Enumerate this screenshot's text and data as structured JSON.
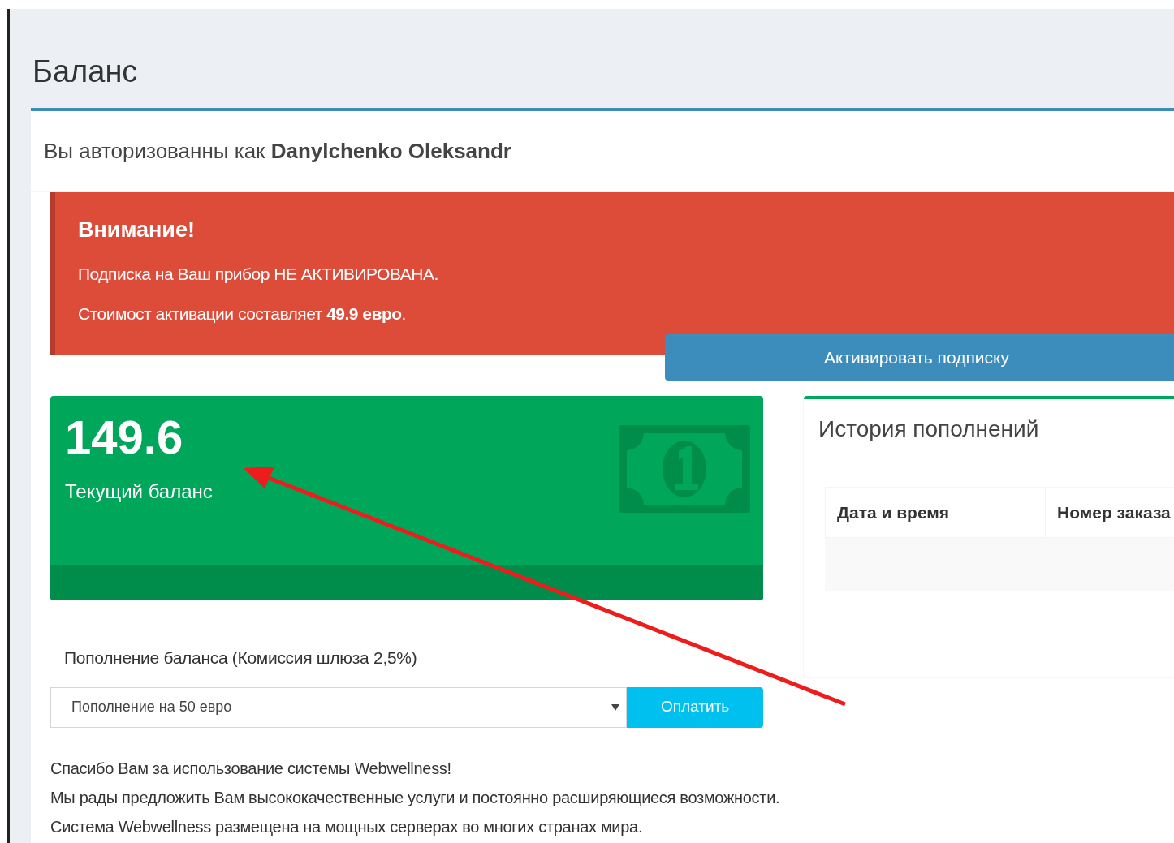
{
  "page_title": "Баланс",
  "auth_line": "Вы авторизованны как **Danylchenko Oleksandr**",
  "alert": {
    "title": "Внимание!",
    "lines": [
      "Подписка на Ваш прибор НЕ АКТИВИРОВАНА.",
      "Стоимост активации составляет **49.9 евро**."
    ],
    "button": "Активировать подписку"
  },
  "balance": {
    "value": "149.6",
    "label": "Текущий баланс"
  },
  "history": {
    "title": "История пополнений",
    "columns": [
      "Дата и время",
      "Номер заказа"
    ]
  },
  "topup": {
    "label": "Пополнение баланса (Комиссия шлюза 2,5%)",
    "value": "Пополнение на 50 евро",
    "button": "Оплатить"
  },
  "footer_lines": [
    "Спасибо Вам за использование системы Webwellness!",
    "Мы рады предложить Вам высококачественные услуги и постоянно расширяющиеся возможности.",
    "Система Webwellness размещена на мощных серверах во многих странах мира."
  ]
}
